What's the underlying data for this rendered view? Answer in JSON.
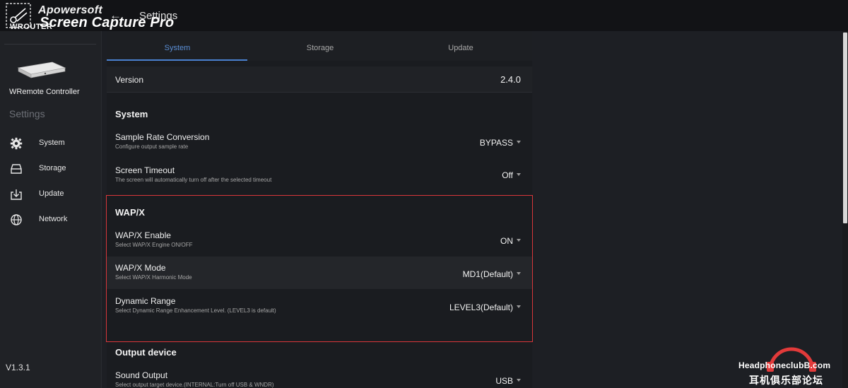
{
  "watermark_brand": {
    "line1": "Apowersoft",
    "line2": "Screen Capture Pro",
    "sub": "WROUTER"
  },
  "header": {
    "back_glyph": "←",
    "title": "Settings"
  },
  "sidebar": {
    "device_name": "WRemote Controller",
    "section_title": "Settings",
    "items": [
      {
        "label": "System",
        "icon": "gear-icon"
      },
      {
        "label": "Storage",
        "icon": "drive-icon"
      },
      {
        "label": "Update",
        "icon": "download-icon"
      },
      {
        "label": "Network",
        "icon": "globe-icon"
      }
    ],
    "version": "V1.3.1"
  },
  "tabs": [
    {
      "label": "System",
      "active": true
    },
    {
      "label": "Storage",
      "active": false
    },
    {
      "label": "Update",
      "active": false
    }
  ],
  "version_row": {
    "label": "Version",
    "value": "2.4.0"
  },
  "system_section": {
    "heading": "System",
    "rows": [
      {
        "title": "Sample Rate Conversion",
        "sub": "Configure output sample rate",
        "value": "BYPASS"
      },
      {
        "title": "Screen Timeout",
        "sub": "The screen will automatically turn off after the selected timeout",
        "value": "Off"
      }
    ]
  },
  "wapx_section": {
    "heading": "WAP/X",
    "rows": [
      {
        "title": "WAP/X Enable",
        "sub": "Select WAP/X Engine ON/OFF",
        "value": "ON"
      },
      {
        "title": "WAP/X Mode",
        "sub": "Select WAP/X Harmonic Mode",
        "value": "MD1(Default)"
      },
      {
        "title": "Dynamic Range",
        "sub": "Select Dynamic Range Enhancement Level. (LEVEL3 is default)",
        "value": "LEVEL3(Default)"
      }
    ]
  },
  "output_section": {
    "heading": "Output device",
    "rows": [
      {
        "title": "Sound Output",
        "sub": "Select output target device.(INTERNAL:Turn off USB & WNDR)",
        "value": "USB"
      }
    ]
  },
  "watermark": {
    "text": "HeadphoneclubB.com",
    "cn": "耳机俱乐部论坛"
  },
  "colors": {
    "accent": "#4a80cf",
    "highlight_border": "#d9363a"
  }
}
